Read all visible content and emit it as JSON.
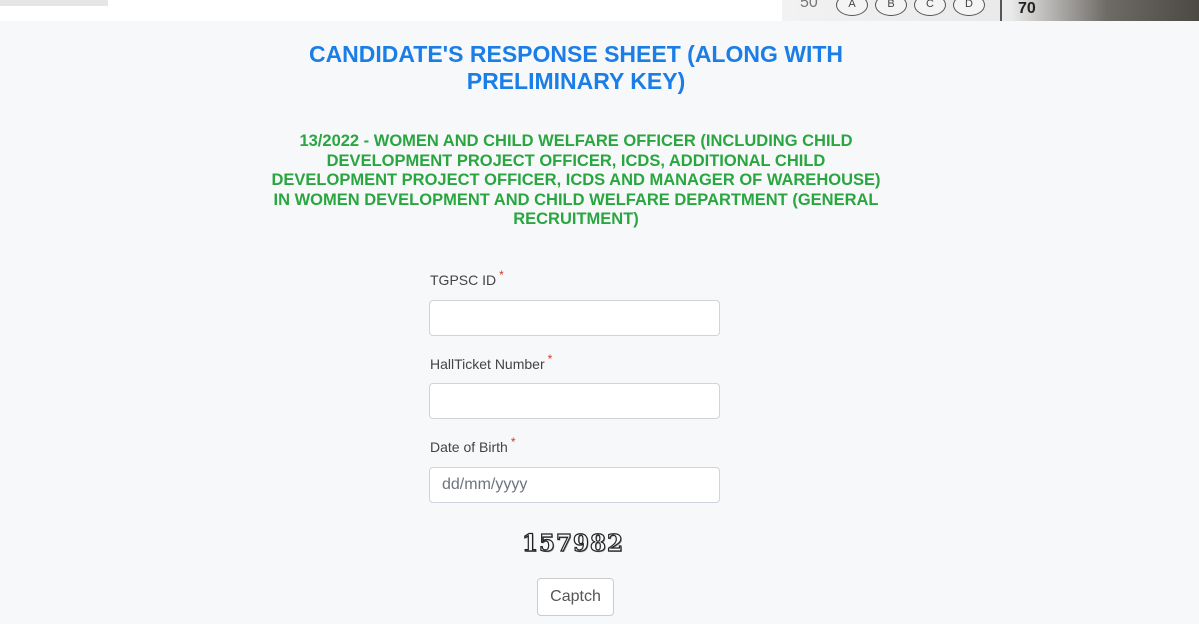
{
  "banner": {
    "bubble_number": "50",
    "bubbles": [
      "A",
      "B",
      "C",
      "D"
    ],
    "side_number": "70"
  },
  "header": {
    "title": "CANDIDATE'S RESPONSE SHEET (ALONG WITH PRELIMINARY KEY)",
    "subtitle": "13/2022 - WOMEN AND CHILD WELFARE OFFICER (INCLUDING CHILD DEVELOPMENT PROJECT OFFICER, ICDS, ADDITIONAL CHILD DEVELOPMENT PROJECT OFFICER, ICDS AND MANAGER OF WAREHOUSE) IN WOMEN DEVELOPMENT AND CHILD WELFARE DEPARTMENT (GENERAL RECRUITMENT)"
  },
  "form": {
    "required_marker": "*",
    "tgpsc_id": {
      "label": "TGPSC ID",
      "value": "",
      "placeholder": ""
    },
    "hallticket": {
      "label": "HallTicket Number",
      "value": "",
      "placeholder": ""
    },
    "dob": {
      "label": "Date of Birth",
      "value": "",
      "placeholder": "dd/mm/yyyy"
    },
    "captcha_code": "157982",
    "captcha_button": "Captch"
  },
  "colors": {
    "title": "#1a7ee6",
    "subtitle": "#2aa640",
    "required": "#d9342b",
    "background": "#f7f8fa"
  }
}
